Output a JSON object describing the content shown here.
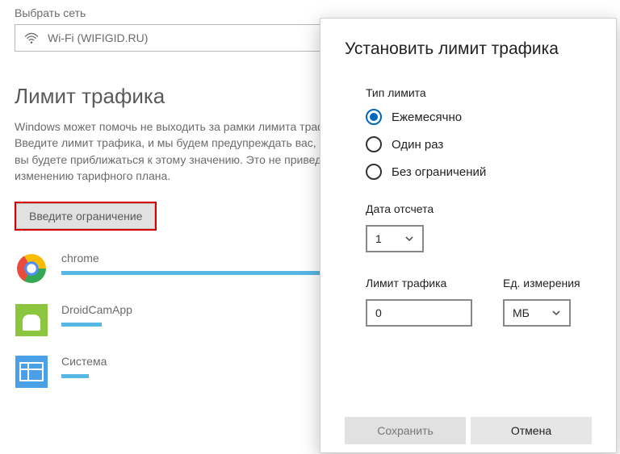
{
  "select_network_label": "Выбрать сеть",
  "network_name": "Wi-Fi (WIFIGID.RU)",
  "section_title": "Лимит трафика",
  "section_desc": "Windows может помочь не выходить за рамки лимита трафика. Введите лимит трафика, и мы будем предупреждать вас, когда вы будете приближаться к этому значению. Это не приведет к изменению тарифного плана.",
  "enter_limit_btn": "Введите ограничение",
  "apps": {
    "chrome": "chrome",
    "droid": "DroidCamApp",
    "system": "Система"
  },
  "dialog": {
    "title": "Установить лимит трафика",
    "limit_type_label": "Тип лимита",
    "options": {
      "monthly": "Ежемесячно",
      "once": "Один раз",
      "unlimited": "Без ограничений"
    },
    "reset_date_label": "Дата отсчета",
    "reset_date_value": "1",
    "data_limit_label": "Лимит трафика",
    "data_limit_value": "0",
    "unit_label": "Ед. измерения",
    "unit_value": "МБ",
    "save": "Сохранить",
    "cancel": "Отмена"
  }
}
